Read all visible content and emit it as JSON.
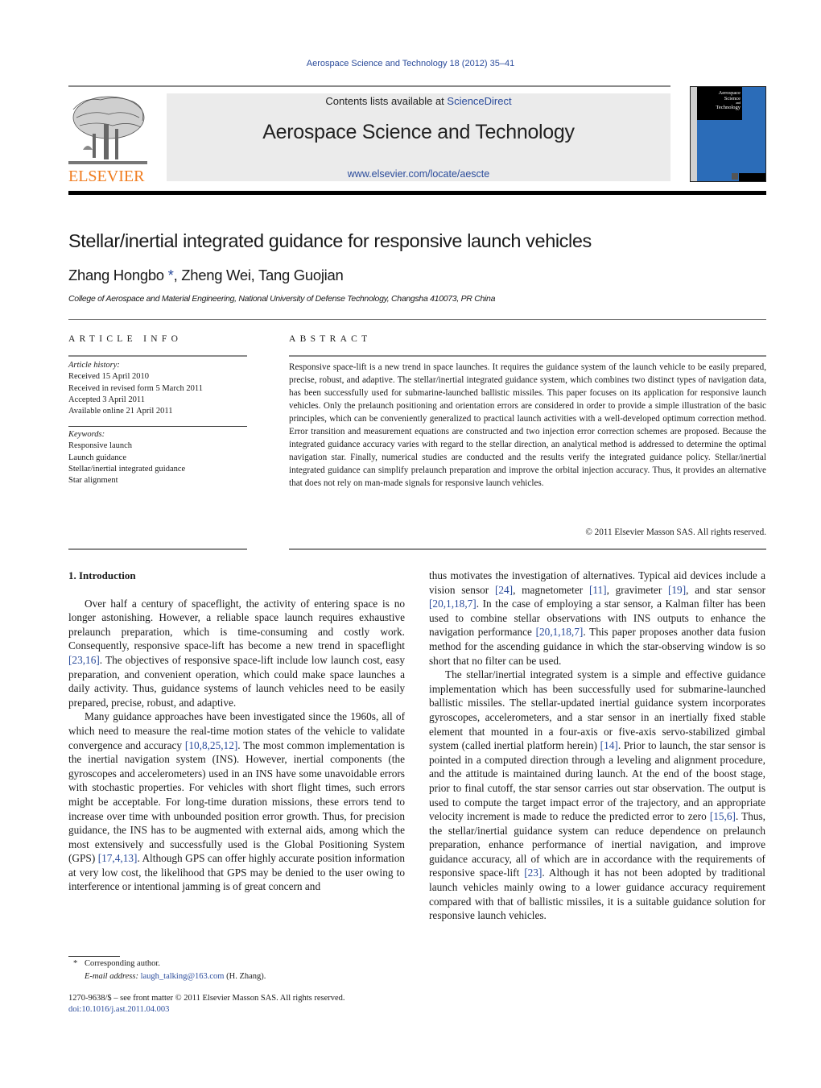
{
  "header": {
    "citation": "Aerospace Science and Technology 18 (2012) 35–41",
    "contents_prefix": "Contents lists available at ",
    "contents_link": "ScienceDirect",
    "journal_title": "Aerospace Science and Technology",
    "journal_url": "www.elsevier.com/locate/aescte",
    "publisher_logo_text": "ELSEVIER",
    "cover": {
      "line1": "Aerospace",
      "line2": "Science",
      "line3": "and",
      "line4": "Technology"
    },
    "colors": {
      "link": "#2a4b9b",
      "elsevier_orange": "#f07c1e",
      "cover_blue": "#2b6cb8",
      "banner_grey": "#ebebeb"
    }
  },
  "article": {
    "title": "Stellar/inertial integrated guidance for responsive launch vehicles",
    "authors": [
      {
        "name": "Zhang Hongbo",
        "mark": "*"
      },
      {
        "name": "Zheng Wei"
      },
      {
        "name": "Tang Guojian"
      }
    ],
    "affiliation": "College of Aerospace and Material Engineering, National University of Defense Technology, Changsha 410073, PR China"
  },
  "article_info": {
    "heading": "ARTICLE INFO",
    "history_label": "Article history:",
    "history": [
      "Received 15 April 2010",
      "Received in revised form 5 March 2011",
      "Accepted 3 April 2011",
      "Available online 21 April 2011"
    ],
    "keywords_label": "Keywords:",
    "keywords": [
      "Responsive launch",
      "Launch guidance",
      "Stellar/inertial integrated guidance",
      "Star alignment"
    ]
  },
  "abstract": {
    "heading": "ABSTRACT",
    "text": "Responsive space-lift is a new trend in space launches. It requires the guidance system of the launch vehicle to be easily prepared, precise, robust, and adaptive. The stellar/inertial integrated guidance system, which combines two distinct types of navigation data, has been successfully used for submarine-launched ballistic missiles. This paper focuses on its application for responsive launch vehicles. Only the prelaunch positioning and orientation errors are considered in order to provide a simple illustration of the basic principles, which can be conveniently generalized to practical launch activities with a well-developed optimum correction method. Error transition and measurement equations are constructed and two injection error correction schemes are proposed. Because the integrated guidance accuracy varies with regard to the stellar direction, an analytical method is addressed to determine the optimal navigation star. Finally, numerical studies are conducted and the results verify the integrated guidance policy. Stellar/inertial integrated guidance can simplify prelaunch preparation and improve the orbital injection accuracy. Thus, it provides an alternative that does not rely on man-made signals for responsive launch vehicles.",
    "copyright": "© 2011 Elsevier Masson SAS. All rights reserved."
  },
  "body": {
    "section_title": "1. Introduction",
    "p1": {
      "a": "Over half a century of spaceflight, the activity of entering space is no longer astonishing. However, a reliable space launch requires exhaustive prelaunch preparation, which is time-consuming and costly work. Consequently, responsive space-lift has become a new trend in spaceflight ",
      "ref1": "[23,16]",
      "b": ". The objectives of responsive space-lift include low launch cost, easy preparation, and convenient operation, which could make space launches a daily activity. Thus, guidance systems of launch vehicles need to be easily prepared, precise, robust, and adaptive."
    },
    "p2": {
      "a": "Many guidance approaches have been investigated since the 1960s, all of which need to measure the real-time motion states of the vehicle to validate convergence and accuracy ",
      "ref1": "[10,8,25,12]",
      "b": ". The most common implementation is the inertial navigation system (INS). However, inertial components (the gyroscopes and accelerometers) used in an INS have some unavoidable errors with stochastic properties. For vehicles with short flight times, such errors might be acceptable. For long-time duration missions, these errors tend to increase over time with unbounded position error growth. Thus, for precision guidance, the INS has to be augmented with external aids, among which the most extensively and successfully used is the Global Positioning System (GPS) ",
      "ref2": "[17,4,13]",
      "c": ". Although GPS can offer highly accurate position information at very low cost, the likelihood that GPS may be denied to the user owing to interference or intentional jamming is of great concern and thus motivates the investigation of alternatives. Typical aid devices include a vision sensor ",
      "ref3": "[24]",
      "d": ", magnetometer ",
      "ref4": "[11]",
      "e": ", gravimeter ",
      "ref5": "[19]",
      "f": ", and star sensor ",
      "ref6": "[20,1,18,7]",
      "g": ". In the case of employing a star sensor, a Kalman filter has been used to combine stellar observations with INS outputs to enhance the navigation performance ",
      "ref7": "[20,1,18,7]",
      "h": ". This paper proposes another data fusion method for the ascending guidance in which the star-observing window is so short that no filter can be used."
    },
    "p3": {
      "a": "The stellar/inertial integrated system is a simple and effective guidance implementation which has been successfully used for submarine-launched ballistic missiles. The stellar-updated inertial guidance system incorporates gyroscopes, accelerometers, and a star sensor in an inertially fixed stable element that mounted in a four-axis or five-axis servo-stabilized gimbal system (called inertial platform herein) ",
      "ref1": "[14]",
      "b": ". Prior to launch, the star sensor is pointed in a computed direction through a leveling and alignment procedure, and the attitude is maintained during launch. At the end of the boost stage, prior to final cutoff, the star sensor carries out star observation. The output is used to compute the target impact error of the trajectory, and an appropriate velocity increment is made to reduce the predicted error to zero ",
      "ref2": "[15,6]",
      "c": ". Thus, the stellar/inertial guidance system can reduce dependence on prelaunch preparation, enhance performance of inertial navigation, and improve guidance accuracy, all of which are in accordance with the requirements of responsive space-lift ",
      "ref3": "[23]",
      "d": ". Although it has not been adopted by traditional launch vehicles mainly owing to a lower guidance accuracy requirement compared with that of ballistic missiles, it is a suitable guidance solution for responsive launch vehicles."
    }
  },
  "footer": {
    "star": "*",
    "corresponding": "Corresponding author.",
    "email_label": "E-mail address:",
    "email": "laugh_talking@163.com",
    "email_suffix": " (H. Zhang).",
    "front_matter": "1270-9638/$ – see front matter  © 2011 Elsevier Masson SAS. All rights reserved.",
    "doi": "doi:10.1016/j.ast.2011.04.003"
  }
}
